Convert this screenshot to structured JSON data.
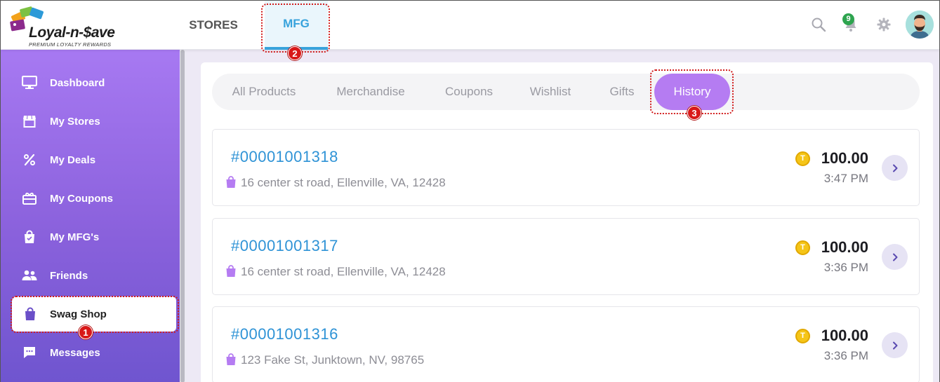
{
  "app": {
    "logo_text": "Loyal-n-$ave",
    "logo_tagline": "PREMIUM LOYALTY REWARDS"
  },
  "header": {
    "tabs": [
      {
        "label": "STORES",
        "active": false
      },
      {
        "label": "MFG",
        "active": true
      }
    ],
    "notification_count": "9",
    "icons": [
      "search-icon",
      "bell-icon",
      "gear-icon",
      "avatar"
    ]
  },
  "sidebar": {
    "items": [
      {
        "label": "Dashboard",
        "icon": "monitor-icon",
        "active": false
      },
      {
        "label": "My Stores",
        "icon": "store-icon",
        "active": false
      },
      {
        "label": "My Deals",
        "icon": "percent-icon",
        "active": false
      },
      {
        "label": "My Coupons",
        "icon": "coupon-icon",
        "active": false
      },
      {
        "label": "My MFG's",
        "icon": "shopping-bag-icon",
        "active": false
      },
      {
        "label": "Friends",
        "icon": "friends-icon",
        "active": false
      },
      {
        "label": "Swag Shop",
        "icon": "swag-bag-icon",
        "active": true
      },
      {
        "label": "Messages",
        "icon": "chat-icon",
        "active": false
      }
    ]
  },
  "main": {
    "tabs": [
      {
        "label": "All Products",
        "active": false
      },
      {
        "label": "Merchandise",
        "active": false
      },
      {
        "label": "Coupons",
        "active": false
      },
      {
        "label": "Wishlist",
        "active": false
      },
      {
        "label": "Gifts",
        "active": false
      },
      {
        "label": "History",
        "active": true
      }
    ],
    "orders": [
      {
        "id": "#00001001318",
        "address": "16 center st road, Ellenville, VA, 12428",
        "amount": "100.00",
        "time": "3:47 PM"
      },
      {
        "id": "#00001001317",
        "address": "16 center st road, Ellenville, VA, 12428",
        "amount": "100.00",
        "time": "3:36 PM"
      },
      {
        "id": "#00001001316",
        "address": "123 Fake St, Junktown, NV, 98765",
        "amount": "100.00",
        "time": "3:36 PM"
      }
    ],
    "coin_symbol": "T"
  },
  "callouts": [
    "1",
    "2",
    "3"
  ],
  "colors": {
    "accent_blue": "#38a3dc",
    "accent_purple": "#b57cf2",
    "sidebar_top": "#a779f2",
    "sidebar_bottom": "#6f55cf",
    "badge_green": "#2ea44f",
    "callout_red": "#d81818"
  }
}
